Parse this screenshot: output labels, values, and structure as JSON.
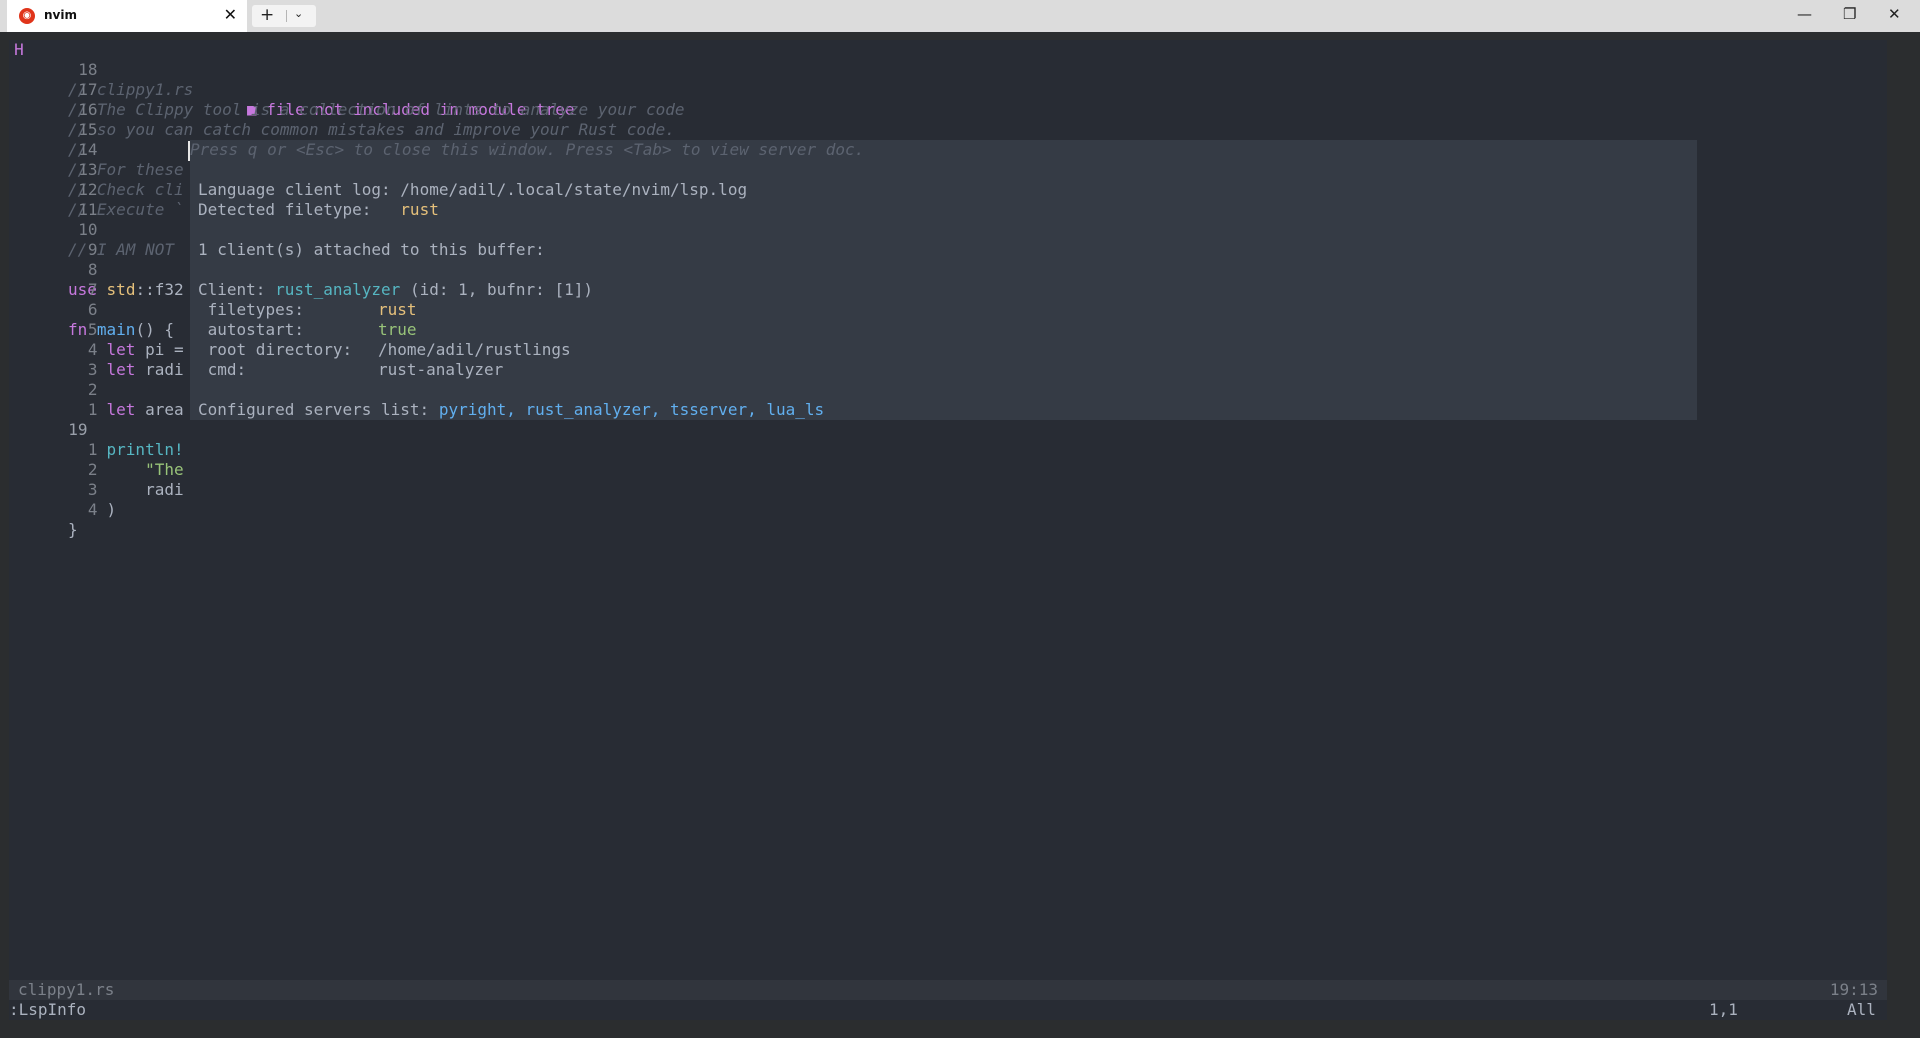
{
  "window": {
    "tab_title": "nvim",
    "tab_icon": "ubuntu-logo-icon",
    "close_glyph": "✕",
    "new_tab_glyph": "+",
    "dropdown_glyph": "⌄",
    "minimize_glyph": "—",
    "maximize_glyph": "❐",
    "window_close_glyph": "✕"
  },
  "editor": {
    "gutter_mark": "H",
    "lines": [
      {
        "num": "18",
        "text": "// clippy1.rs"
      },
      {
        "num": "17",
        "text": "// The Clippy tool is a collection of lints to analyze your code"
      },
      {
        "num": "16",
        "text": "// so you can catch common mistakes and improve your Rust code."
      },
      {
        "num": "15",
        "text": "//"
      },
      {
        "num": "14",
        "text": "// For these exercises the code will fail to compile when there are clippy warnings"
      },
      {
        "num": "13",
        "text": "// Check cli"
      },
      {
        "num": "12",
        "text": "// Execute `"
      },
      {
        "num": "11",
        "text": ""
      },
      {
        "num": "10",
        "text": "// I AM NOT"
      },
      {
        "num": "9",
        "text": ""
      },
      {
        "num": "8",
        "text_kw": "use",
        "text_ty": "std",
        "text_rest": "::f32"
      },
      {
        "num": "7",
        "text": ""
      },
      {
        "num": "6",
        "text_kw": "fn",
        "text_fn": "main",
        "text_rest": "() {"
      },
      {
        "num": "5",
        "text_kw": "let",
        "text_rest": " pi ="
      },
      {
        "num": "4",
        "text_kw": "let",
        "text_rest": " radi"
      },
      {
        "num": "3",
        "text": ""
      },
      {
        "num": "2",
        "text_kw": "let",
        "text_rest": " area"
      },
      {
        "num": "1",
        "text": ""
      },
      {
        "num": "19",
        "text_mac": "println!"
      },
      {
        "num": "1",
        "text_str": "\"The"
      },
      {
        "num": "2",
        "text": "radi"
      },
      {
        "num": "3",
        "text": ")"
      },
      {
        "num": "4",
        "text": "}"
      }
    ],
    "diagnostic": "■ file not included in module tree"
  },
  "lspinfo": {
    "hint": "Press q or <Esc> to close this window. Press <Tab> to view server doc.",
    "log_label": "Language client log:",
    "log_path": "/home/adil/.local/state/nvim/lsp.log",
    "filetype_label": "Detected filetype:",
    "filetype": "rust",
    "attached": "1 client(s) attached to this buffer:",
    "client_label": "Client:",
    "client_name": "rust_analyzer",
    "client_meta": "(id: 1, bufnr: [1])",
    "filetypes_label": "filetypes:",
    "filetypes": "rust",
    "autostart_label": "autostart:",
    "autostart": "true",
    "root_label": "root directory:",
    "root": "/home/adil/rustlings",
    "cmd_label": "cmd:",
    "cmd": "rust-analyzer",
    "servers_label": "Configured servers list:",
    "servers": "pyright, rust_analyzer, tsserver, lua_ls"
  },
  "statusline": {
    "filename": "clippy1.rs",
    "clock": "19:13"
  },
  "cmdline": {
    "command": ":LspInfo",
    "position": "1,1",
    "scroll": "All"
  }
}
